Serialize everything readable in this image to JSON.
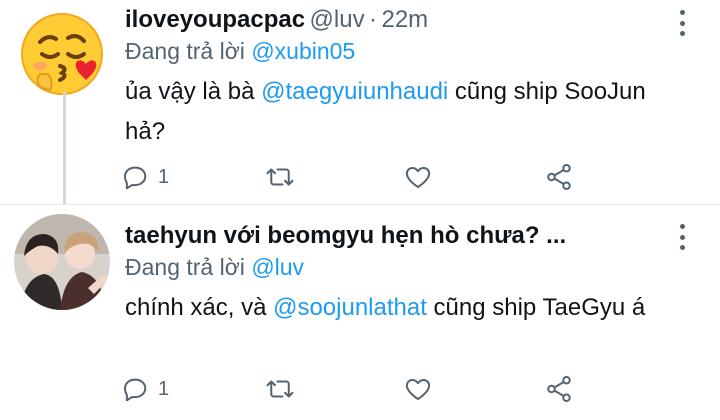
{
  "tweets": [
    {
      "name": "iloveyoupacpac",
      "handle": "@luv",
      "separator": "·",
      "time": "22m",
      "reply_prefix": "Đang trả lời",
      "reply_to": "@xubin05",
      "body_before": "ủa vậy là bà ",
      "body_mention": "@taegyuiunhaudi",
      "body_after": " cũng ship SooJun hả?",
      "reply_count": "1",
      "avatar_icon": "emoji-blowing-kiss-icon"
    },
    {
      "name": "taehyun với beomgyu hẹn hò chưa? ...",
      "reply_prefix": "Đang trả lời",
      "reply_to": "@luv",
      "body_before": "chính xác, và ",
      "body_mention": "@soojunlathat",
      "body_after": " cũng ship TaeGyu á",
      "reply_count": "1",
      "avatar_icon": "profile-photo"
    }
  ],
  "colors": {
    "mention": "#1d9bf0",
    "secondary_text": "#536471",
    "icon": "#536471",
    "thread_line": "#cfd9de"
  },
  "icons": [
    "comment-icon",
    "retweet-icon",
    "heart-icon",
    "share-icon",
    "more-icon"
  ]
}
